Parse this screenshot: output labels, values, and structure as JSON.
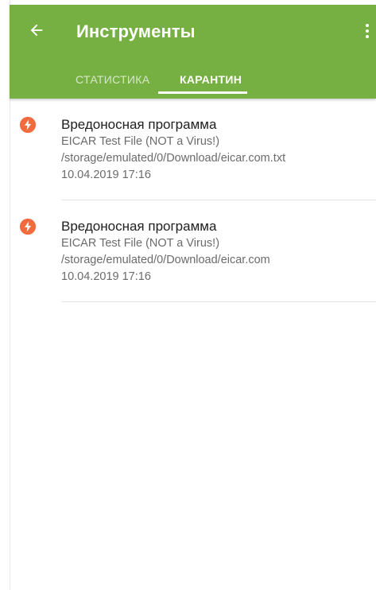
{
  "appbar": {
    "title": "Инструменты",
    "accent_color": "#76b043",
    "back_icon": "arrow-left-icon",
    "more_icon": "more-vert-icon"
  },
  "tabs": [
    {
      "label": "СТАТИСТИКА",
      "selected": false
    },
    {
      "label": "КАРАНТИН",
      "selected": true
    }
  ],
  "items": [
    {
      "icon": "threat-bolt-icon",
      "title": "Вредоносная программа",
      "name": "EICAR Test File (NOT a Virus!)",
      "path": "/storage/emulated/0/Download/eicar.com.txt",
      "date": "10.04.2019 17:16"
    },
    {
      "icon": "threat-bolt-icon",
      "title": "Вредоносная программа",
      "name": "EICAR Test File (NOT a Virus!)",
      "path": "/storage/emulated/0/Download/eicar.com",
      "date": "10.04.2019 17:16"
    }
  ],
  "colors": {
    "threat_icon": "#f26a3d"
  }
}
